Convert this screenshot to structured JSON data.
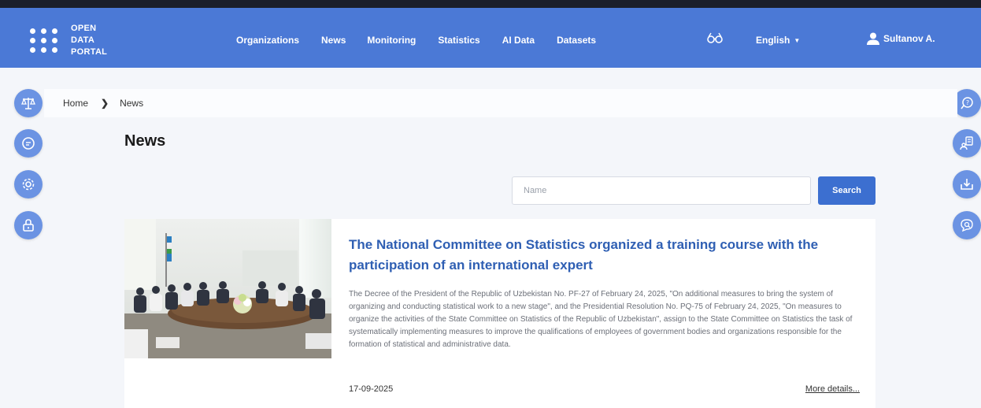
{
  "header": {
    "logo_lines": [
      "OPEN",
      "DATA",
      "PORTAL"
    ],
    "nav": [
      "Organizations",
      "News",
      "Monitoring",
      "Statistics",
      "AI Data",
      "Datasets"
    ],
    "language": "English",
    "user": "Sultanov A."
  },
  "breadcrumb": {
    "home": "Home",
    "separator": "❯",
    "current": "News"
  },
  "page": {
    "title": "News"
  },
  "search": {
    "placeholder": "Name",
    "value": "",
    "button_label": "Search"
  },
  "news": [
    {
      "title": "The National Committee on Statistics organized a training course with the participation of an international expert",
      "description": "The Decree of the President of the Republic of Uzbekistan No. PF-27 of February 24, 2025, \"On additional measures to bring the system of organizing and conducting statistical work to a new stage\", and the Presidential Resolution No. PQ-75 of February 24, 2025, \"On measures to organize the activities of the State Committee on Statistics of the Republic of Uzbekistan\", assign to the State Committee on Statistics the task of systematically implementing measures to improve the qualifications of employees of government bodies and organizations responsible for the formation of statistical and administrative data.",
      "date": "17-09-2025",
      "more_label": "More details..."
    }
  ],
  "colors": {
    "header": "#4b79d6",
    "accent": "#3c6fd0",
    "side_button": "#6b93e3",
    "title_link": "#2f5fb3"
  },
  "icons": {
    "left_sidebar": [
      "scales-icon",
      "chat-icon",
      "gear-icon",
      "lock-icon"
    ],
    "right_sidebar": [
      "question-chat-icon",
      "user-document-icon",
      "download-icon",
      "search-comment-icon"
    ]
  }
}
